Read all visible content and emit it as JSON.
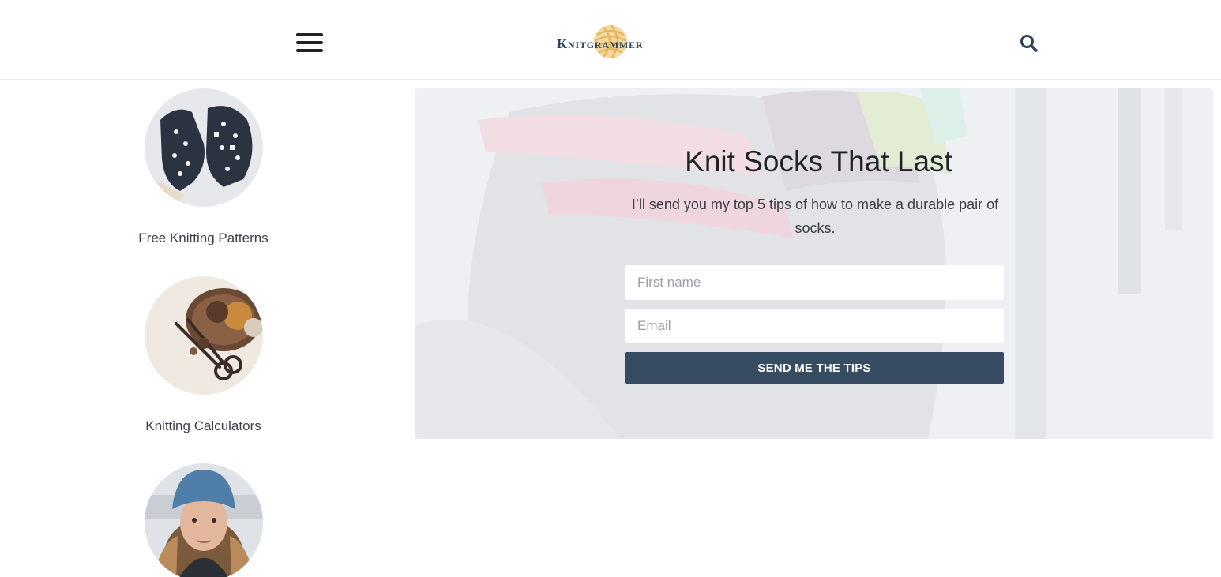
{
  "header": {
    "menu_icon": "hamburger-menu-icon",
    "logo_text": "Knitgrammer",
    "search_icon": "search-icon"
  },
  "sidebar": {
    "items": [
      {
        "label": "Free Knitting Patterns",
        "image": "knitted-mittens-photo"
      },
      {
        "label": "Knitting Calculators",
        "image": "yarn-basket-scissors-photo"
      },
      {
        "label": "",
        "image": "author-portrait-photo"
      }
    ]
  },
  "hero": {
    "title": "Knit Socks That Last",
    "subtitle": "I’ll send you my top 5 tips of how to make a durable pair of socks.",
    "first_name_placeholder": "First name",
    "email_placeholder": "Email",
    "submit_label": "SEND ME THE TIPS"
  },
  "colors": {
    "brand_dark": "#2f4358",
    "button": "#374b63",
    "logo_accent": "#e8c173"
  }
}
